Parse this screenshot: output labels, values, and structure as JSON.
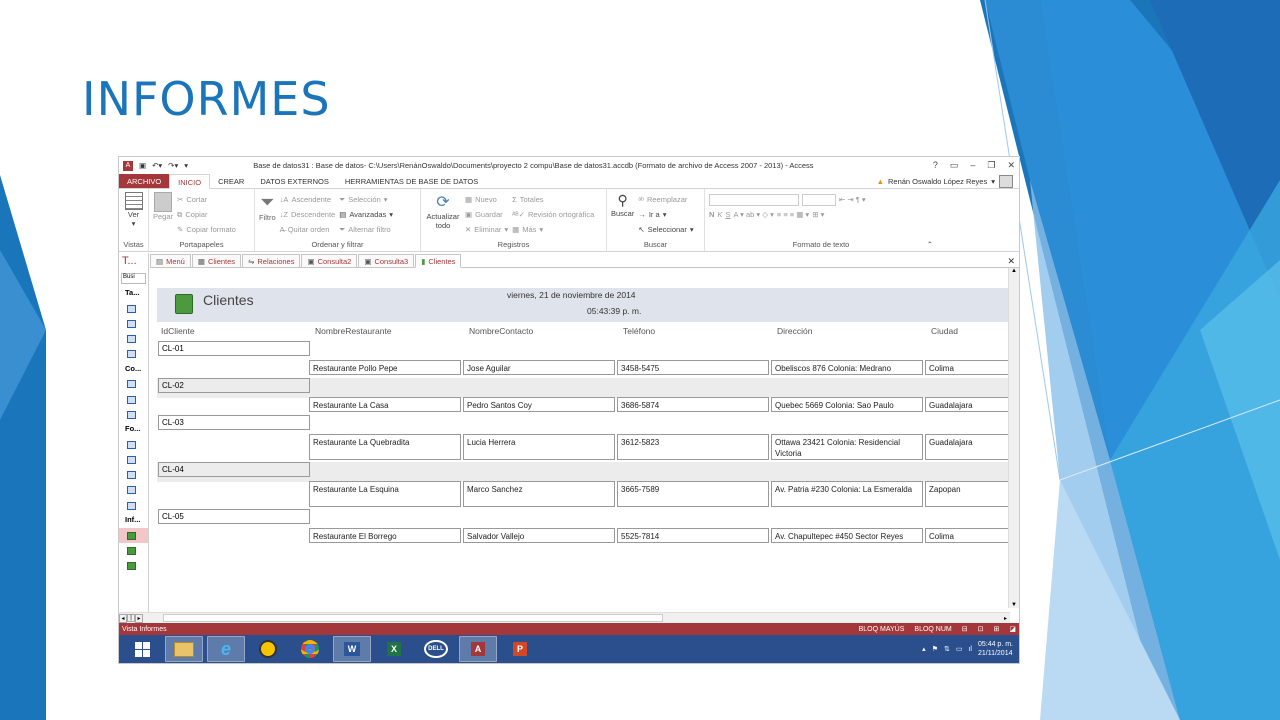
{
  "slide": {
    "title": "INFORMES"
  },
  "window": {
    "title": "Base de datos31 : Base de datos- C:\\Users\\RenánOswaldo\\Documents\\proyecto 2 compu\\Base de datos31.accdb (Formato de archivo de Access 2007 - 2013) - Access",
    "controls": [
      "?",
      "▭",
      "–",
      "❐",
      "✕"
    ]
  },
  "ribbon_tabs": [
    "ARCHIVO",
    "INICIO",
    "CREAR",
    "DATOS EXTERNOS",
    "HERRAMIENTAS DE BASE DE DATOS"
  ],
  "user": "Renán Oswaldo López Reyes",
  "ribbon": {
    "vistas": {
      "ver": "Ver",
      "label": "Vistas"
    },
    "portapapeles": {
      "pegar": "Pegar",
      "cortar": "Cortar",
      "copiar": "Copiar",
      "copiar_formato": "Copiar formato",
      "label": "Portapapeles"
    },
    "ordenar": {
      "filtro": "Filtro",
      "ascendente": "Ascendente",
      "descendente": "Descendente",
      "quitar": "Quitar orden",
      "seleccion": "Selección",
      "avanzadas": "Avanzadas",
      "alternar": "Alternar filtro",
      "label": "Ordenar y filtrar"
    },
    "registros": {
      "actualizar": "Actualizar todo",
      "nuevo": "Nuevo",
      "guardar": "Guardar",
      "eliminar": "Eliminar",
      "totales": "Totales",
      "ortografia": "Revisión ortográfica",
      "mas": "Más",
      "label": "Registros"
    },
    "buscar": {
      "buscar": "Buscar",
      "reemplazar": "Reemplazar",
      "ira": "Ir a",
      "seleccionar": "Seleccionar",
      "label": "Buscar"
    },
    "formato": {
      "label": "Formato de texto",
      "n": "N",
      "k": "K",
      "s": "S"
    }
  },
  "nav": {
    "header": "T...",
    "search": "Busi",
    "sections": [
      {
        "label": "Ta...",
        "count": 4
      },
      {
        "label": "Co...",
        "count": 3
      },
      {
        "label": "Fo...",
        "count": 5
      },
      {
        "label": "Inf...",
        "count": 3
      }
    ]
  },
  "doc_tabs": [
    "Menú",
    "Clientes",
    "Relaciones",
    "Consulta2",
    "Consulta3",
    "Clientes"
  ],
  "report": {
    "title": "Clientes",
    "date": "viernes, 21 de noviembre de 2014",
    "time": "05:43:39 p. m.",
    "columns": [
      "IdCliente",
      "NombreRestaurante",
      "NombreContacto",
      "Teléfono",
      "Dirección",
      "Ciudad"
    ],
    "groups": [
      {
        "id": "CL-01",
        "restaurante": "Restaurante Pollo Pepe",
        "contacto": "Jose Aguilar",
        "telefono": "3458-5475",
        "direccion": "Obeliscos 876 Colonia: Medrano",
        "ciudad": "Colima"
      },
      {
        "id": "CL-02",
        "restaurante": "Restaurante La Casa",
        "contacto": "Pedro Santos Coy",
        "telefono": "3686-5874",
        "direccion": "Quebec 5669 Colonia: Sao Paulo",
        "ciudad": "Guadalajara"
      },
      {
        "id": "CL-03",
        "restaurante": "Restaurante La Quebradita",
        "contacto": "Lucia Herrera",
        "telefono": "3612-5823",
        "direccion": "Ottawa 23421 Colonia: Residencial Victoria",
        "ciudad": "Guadalajara"
      },
      {
        "id": "CL-04",
        "restaurante": "Restaurante La Esquina",
        "contacto": "Marco Sanchez",
        "telefono": "3665-7589",
        "direccion": "Av. Patria #230 Colonia: La Esmeralda",
        "ciudad": "Zapopan"
      },
      {
        "id": "CL-05",
        "restaurante": "Restaurante El Borrego",
        "contacto": "Salvador Vallejo",
        "telefono": "5525-7814",
        "direccion": "Av. Chapultepec #450 Sector Reyes",
        "ciudad": "Colima"
      }
    ],
    "count": "5"
  },
  "status": {
    "left": "Vista Informes",
    "caps": "BLOQ MAYÚS",
    "num": "BLOQ NUM"
  },
  "taskbar": {
    "apps": [
      "explorer",
      "ie",
      "norton",
      "chrome",
      "W",
      "X",
      "DELL",
      "A",
      "P"
    ],
    "clock_time": "05:44 p. m.",
    "clock_date": "21/11/2014"
  },
  "colors": {
    "accent": "#a4373a",
    "title_blue": "#1b75bb",
    "taskbar": "#2a4f8c"
  }
}
